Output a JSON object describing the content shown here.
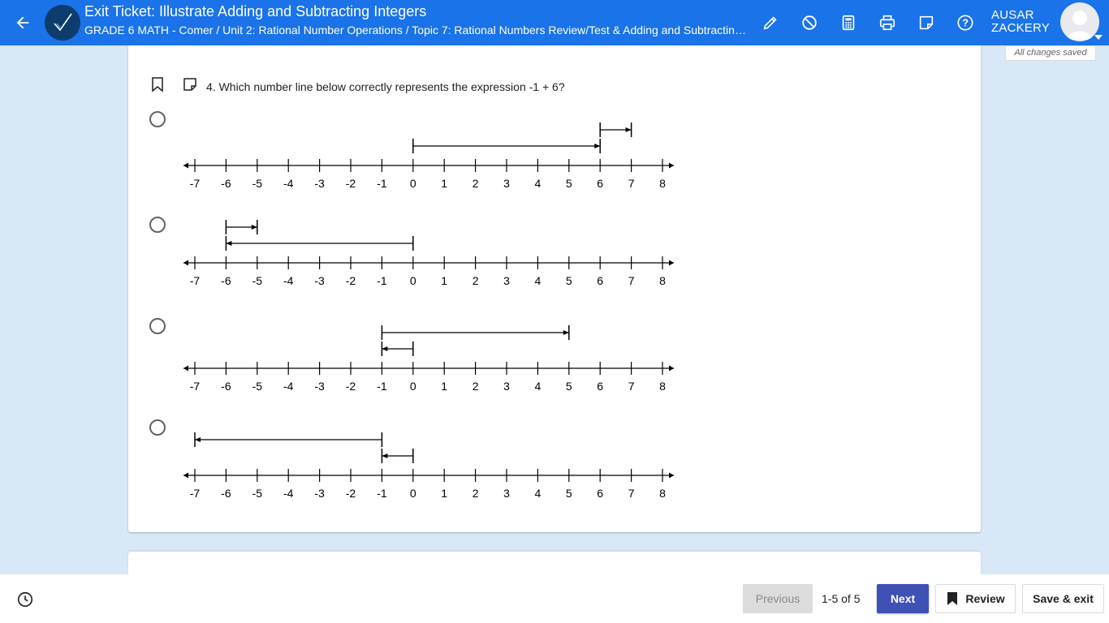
{
  "header": {
    "title": "Exit Ticket: Illustrate Adding and Subtracting Integers",
    "breadcrumb": "GRADE 6 MATH - Comer / Unit 2: Rational Number Operations / Topic 7: Rational Numbers Review/Test & Adding and Subtracting Integers",
    "user_name_line1": "AUSAR",
    "user_name_line2": "ZACKERY",
    "save_status": "All changes saved",
    "tools": [
      "highlighter-icon",
      "answer-eliminator-icon",
      "calculator-icon",
      "print-icon",
      "notepad-icon",
      "help-icon"
    ]
  },
  "question": {
    "number_and_text": "4. Which number line below correctly represents the expression -1 + 6?",
    "options": [
      {
        "ticks": [
          "-7",
          "-6",
          "-5",
          "-4",
          "-3",
          "-2",
          "-1",
          "0",
          "1",
          "2",
          "3",
          "4",
          "5",
          "6",
          "7",
          "8"
        ],
        "arrows": [
          {
            "from": 0,
            "to": 6,
            "level": 1
          },
          {
            "from": 6,
            "to": 7,
            "level": 2
          }
        ]
      },
      {
        "ticks": [
          "-7",
          "-6",
          "-5",
          "-4",
          "-3",
          "-2",
          "-1",
          "0",
          "1",
          "2",
          "3",
          "4",
          "5",
          "6",
          "7",
          "8"
        ],
        "arrows": [
          {
            "from": -6,
            "to": -5,
            "level": 2
          },
          {
            "from": 0,
            "to": -6,
            "level": 1
          }
        ]
      },
      {
        "ticks": [
          "-7",
          "-6",
          "-5",
          "-4",
          "-3",
          "-2",
          "-1",
          "0",
          "1",
          "2",
          "3",
          "4",
          "5",
          "6",
          "7",
          "8"
        ],
        "arrows": [
          {
            "from": -1,
            "to": 5,
            "level": 2
          },
          {
            "from": 0,
            "to": -1,
            "level": 1
          }
        ]
      },
      {
        "ticks": [
          "-7",
          "-6",
          "-5",
          "-4",
          "-3",
          "-2",
          "-1",
          "0",
          "1",
          "2",
          "3",
          "4",
          "5",
          "6",
          "7",
          "8"
        ],
        "arrows": [
          {
            "from": -1,
            "to": -7,
            "level": 2
          },
          {
            "from": 0,
            "to": -1,
            "level": 1
          }
        ]
      }
    ]
  },
  "footer": {
    "previous_label": "Previous",
    "pagination": "1-5 of 5",
    "next_label": "Next",
    "review_label": "Review",
    "save_exit_label": "Save & exit"
  },
  "colors": {
    "header_bg": "#1a73e8",
    "page_bg": "#d9e8f7",
    "next_button": "#3f51b5"
  }
}
